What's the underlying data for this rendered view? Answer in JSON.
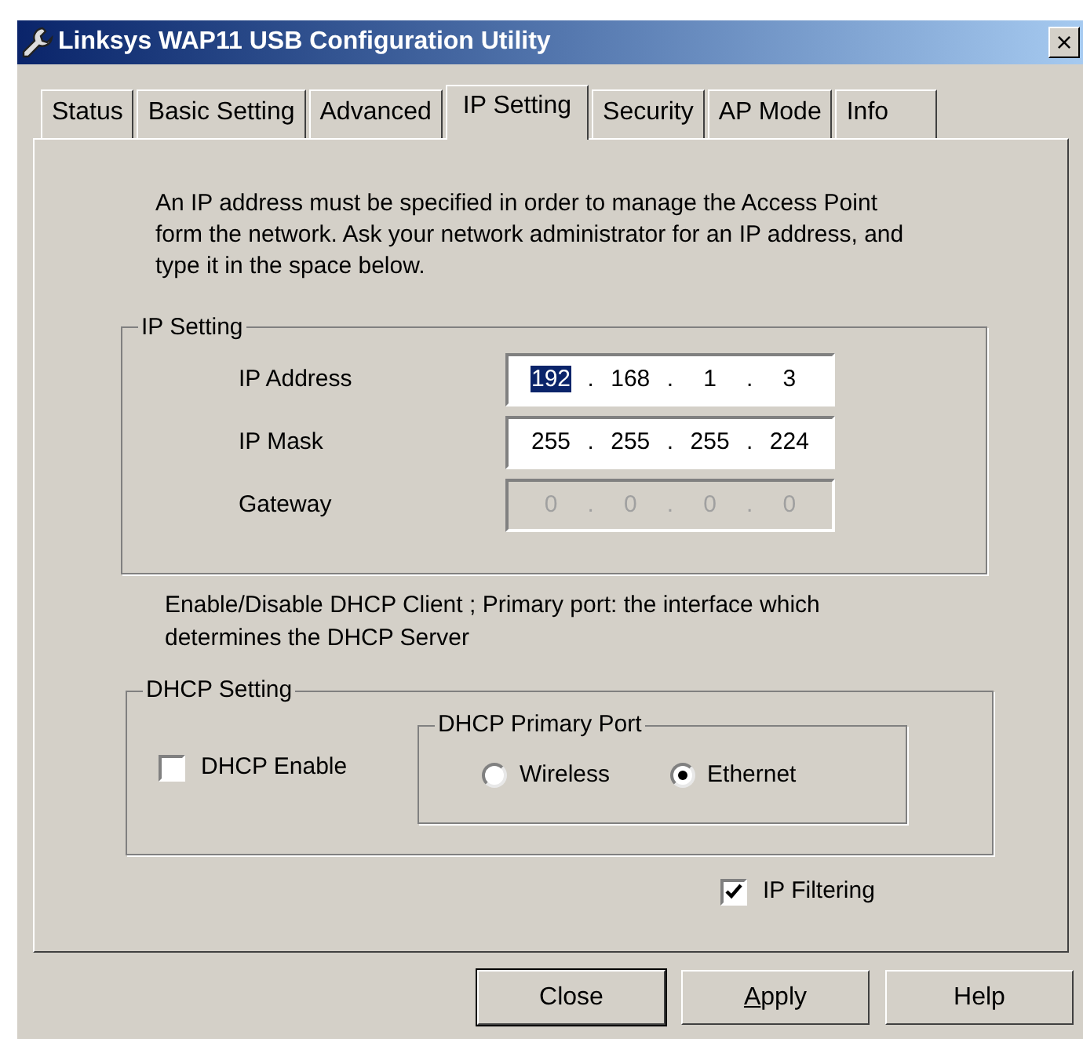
{
  "window": {
    "title": "Linksys WAP11 USB Configuration Utility",
    "close": "×"
  },
  "tabs": [
    {
      "label": "Status",
      "selected": false
    },
    {
      "label": "Basic Setting",
      "selected": false
    },
    {
      "label": "Advanced",
      "selected": false
    },
    {
      "label": "IP Setting",
      "selected": true
    },
    {
      "label": "Security",
      "selected": false
    },
    {
      "label": "AP Mode",
      "selected": false
    },
    {
      "label": "Info",
      "selected": false
    }
  ],
  "intro": "An IP address must be specified in order to manage the Access Point form the network. Ask your network administrator for an IP address, and type it in the space below.",
  "ip_setting": {
    "title": "IP Setting",
    "separator": ".",
    "fields": [
      {
        "label": "IP Address",
        "disabled": false,
        "octets": [
          {
            "value": "192",
            "selected": true
          },
          {
            "value": "168",
            "selected": false
          },
          {
            "value": "1",
            "selected": false
          },
          {
            "value": "3",
            "selected": false
          }
        ]
      },
      {
        "label": "IP Mask",
        "disabled": false,
        "octets": [
          {
            "value": "255",
            "selected": false
          },
          {
            "value": "255",
            "selected": false
          },
          {
            "value": "255",
            "selected": false
          },
          {
            "value": "224",
            "selected": false
          }
        ]
      },
      {
        "label": "Gateway",
        "disabled": true,
        "octets": [
          {
            "value": "0",
            "selected": false
          },
          {
            "value": "0",
            "selected": false
          },
          {
            "value": "0",
            "selected": false
          },
          {
            "value": "0",
            "selected": false
          }
        ]
      }
    ]
  },
  "dhcp_note": "Enable/Disable DHCP Client ; Primary port: the interface which determines the DHCP Server",
  "dhcp_setting": {
    "title": "DHCP Setting",
    "enable": {
      "label": "DHCP Enable",
      "checked": false
    },
    "primary_port": {
      "title": "DHCP Primary Port",
      "options": [
        {
          "label": "Wireless",
          "selected": false
        },
        {
          "label": "Ethernet",
          "selected": true
        }
      ]
    }
  },
  "ip_filtering": {
    "label": "IP Filtering",
    "checked": true
  },
  "buttons": [
    {
      "label": "Close",
      "default": true,
      "mnemonic": false
    },
    {
      "label": "Apply",
      "default": false,
      "mnemonic": true
    },
    {
      "label": "Help",
      "default": false,
      "mnemonic": false
    }
  ]
}
